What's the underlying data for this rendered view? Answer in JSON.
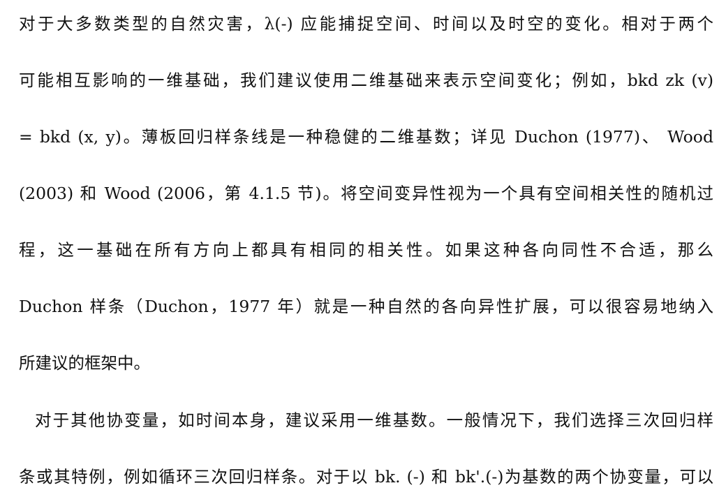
{
  "paragraph1": {
    "lines": [
      "对于大多数类型的自然灾害，λ(-) 应能捕捉空间、时间以及时空的变化。相对于两个",
      "可能相互影响的一维基础，我们建议使用二维基础来表示空间变化；例如，bkd zk (v)",
      "= bkd (x, y)。薄板回归样条线是一种稳健的二维基数；详见 Duchon (1977)、 Wood",
      "(2003) 和 Wood (2006，第 4.1.5 节)。将空间变异性视为一个具有空间相关性的随机过",
      "程，这一基础在所有方向上都具有相同的相关性。如果这种各向同性不合适，那么",
      "Duchon 样条（Duchon，1977 年）就是一种自然的各向异性扩展，可以很容易地纳入",
      "所建议的框架中。"
    ]
  },
  "paragraph2": {
    "lines": [
      "对于其他协变量，如时间本身，建议采用一维基数。一般情况下，我们选择三次回归样",
      "条或其特例，例如循环三次回归样条。对于以 bk. (-) 和 bk'.(-)为基数的两个协变量，可以"
    ]
  }
}
